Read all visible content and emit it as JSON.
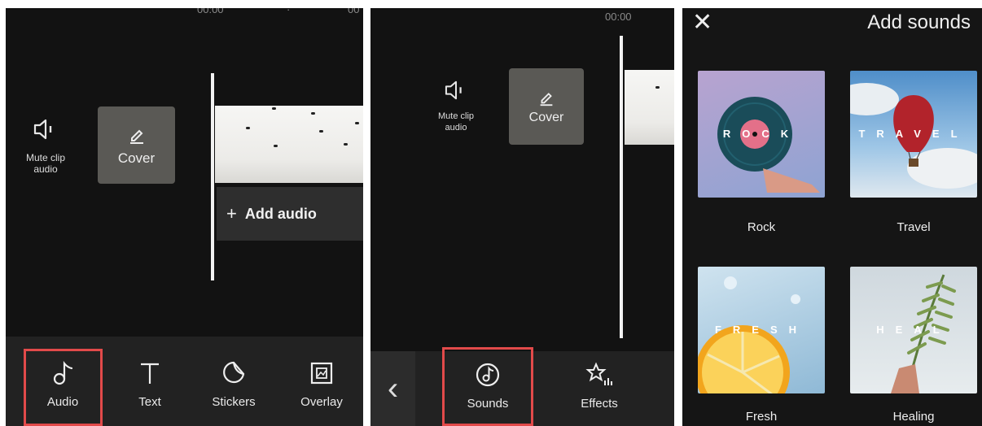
{
  "panel1": {
    "timeline": {
      "ts_left": "00:00",
      "ts_dot": "·",
      "ts_right": "00"
    },
    "mute": {
      "label_line1": "Mute clip",
      "label_line2": "audio"
    },
    "cover": {
      "label": "Cover"
    },
    "add_audio": {
      "label": "Add audio",
      "plus": "+"
    },
    "toolbar": [
      {
        "label": "Audio",
        "icon": "music-note-icon",
        "highlighted": true
      },
      {
        "label": "Text",
        "icon": "text-icon"
      },
      {
        "label": "Stickers",
        "icon": "sticker-icon"
      },
      {
        "label": "Overlay",
        "icon": "overlay-icon"
      }
    ]
  },
  "panel2": {
    "timeline": {
      "ts": "00:00"
    },
    "mute": {
      "label_line1": "Mute clip",
      "label_line2": "audio"
    },
    "cover": {
      "label": "Cover"
    },
    "toolbar": [
      {
        "label": "Sounds",
        "icon": "sounds-icon",
        "highlighted": true
      },
      {
        "label": "Effects",
        "icon": "effects-icon"
      }
    ],
    "back_glyph": "‹"
  },
  "panel3": {
    "header": {
      "title": "Add sounds",
      "close_glyph": "✕"
    },
    "categories": [
      {
        "label": "Rock",
        "overlay": "ROCK"
      },
      {
        "label": "Travel",
        "overlay": "TRAVEL"
      },
      {
        "label": "Fresh",
        "overlay": "FRESH"
      },
      {
        "label": "Healing",
        "overlay": "HEAL"
      }
    ]
  },
  "colors": {
    "highlight": "#e24a4a",
    "background": "#121212",
    "toolbar": "#222222"
  }
}
